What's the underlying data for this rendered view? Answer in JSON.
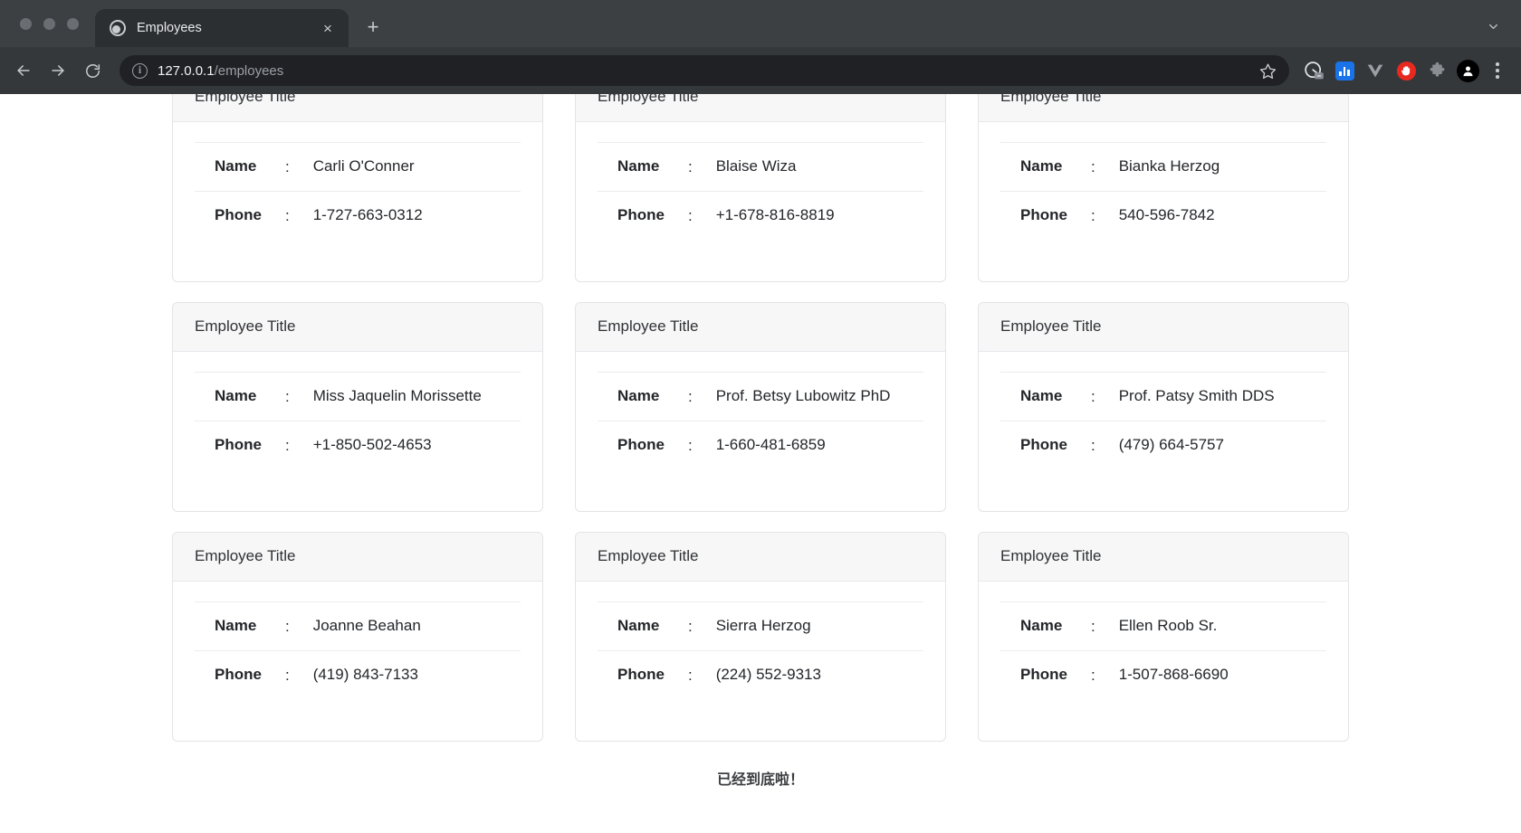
{
  "browser": {
    "window_controls": [
      "close",
      "minimize",
      "maximize"
    ],
    "tab": {
      "title": "Employees",
      "favicon": "globe-icon",
      "close_label": "×"
    },
    "new_tab_label": "+",
    "tab_list_icon": "chevron-down-icon",
    "nav": {
      "back_label": "←",
      "forward_label": "→",
      "reload_label": "⟳"
    },
    "omnibox": {
      "info_icon": "info-circle-icon",
      "host": "127.0.0.1",
      "path": "/employees",
      "bookmark_icon": "star-icon"
    },
    "extensions": [
      {
        "name": "screenshot-extension-icon",
        "color": "#d8d9dd"
      },
      {
        "name": "analytics-extension-icon",
        "color": "#1a73e8"
      },
      {
        "name": "vimium-extension-icon",
        "color": "#9aa0a6"
      },
      {
        "name": "adblock-stop-hand-icon",
        "color": "#e8291f"
      },
      {
        "name": "extensions-puzzle-icon",
        "color": "#8a8e92"
      }
    ],
    "profile_icon": "person-avatar-icon",
    "menu_icon": "kebab-menu-icon"
  },
  "page": {
    "card_title": "Employee Title",
    "labels": {
      "name": "Name",
      "phone": "Phone",
      "separator": ":"
    },
    "end_note": "已经到底啦！",
    "employees": [
      {
        "name": "Carli O'Conner",
        "phone": "1-727-663-0312"
      },
      {
        "name": "Blaise Wiza",
        "phone": "+1-678-816-8819"
      },
      {
        "name": "Bianka Herzog",
        "phone": "540-596-7842"
      },
      {
        "name": "Miss Jaquelin Morissette",
        "phone": "+1-850-502-4653"
      },
      {
        "name": "Prof. Betsy Lubowitz PhD",
        "phone": "1-660-481-6859"
      },
      {
        "name": "Prof. Patsy Smith DDS",
        "phone": "(479) 664-5757"
      },
      {
        "name": "Joanne Beahan",
        "phone": "(419) 843-7133"
      },
      {
        "name": "Sierra Herzog",
        "phone": "(224) 552-9313"
      },
      {
        "name": "Ellen Roob Sr.",
        "phone": "1-507-868-6690"
      }
    ]
  }
}
